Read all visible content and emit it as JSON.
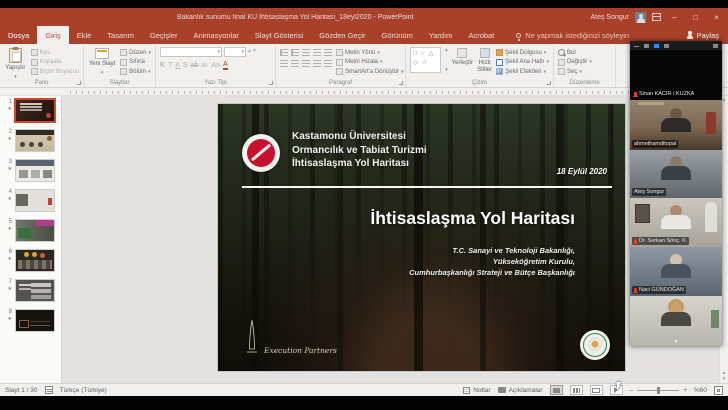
{
  "chrome": {
    "title": "Bakanlık sunumu final KU İhtisaslaşma Yol Haritası_18eyl2020  -  PowerPoint",
    "user_name": "Ateş Songur",
    "minimize": "–",
    "maximize": "□",
    "close": "×"
  },
  "icons": {
    "dropdown": "▾",
    "up": "▴",
    "down": "▾",
    "star": "★"
  },
  "ribbon": {
    "tabs": [
      "Dosya",
      "Giriş",
      "Ekle",
      "Tasarım",
      "Geçişler",
      "Animasyonlar",
      "Slayt Gösterisi",
      "Gözden Geçir",
      "Görünüm",
      "Yardım",
      "Acrobat"
    ],
    "selected_tab": "Giriş",
    "search_hint": "Ne yapmak istediğinizi söyleyin",
    "share": "Paylaş",
    "groups": {
      "pano": {
        "label": "Pano",
        "paste": "Yapıştır",
        "cut": "Kes",
        "copy": "Kopyala",
        "painter": "Biçim Boyacısı"
      },
      "slaytlar": {
        "label": "Slaytlar",
        "new_slide": "Yeni Slayt",
        "layout": "Düzen",
        "reset": "Sıfırla",
        "section": "Bölüm"
      },
      "yazitipi": {
        "label": "Yazı Tipi",
        "styles": [
          "K",
          "T",
          "A",
          "S",
          "ab",
          "AV",
          "Aa",
          "A"
        ]
      },
      "paragraf": {
        "label": "Paragraf",
        "text_direction": "Metin Yönü",
        "align_text": "Metni Hizala",
        "smartart": "SmartArt'a Dönüştür"
      },
      "cizim": {
        "label": "Çizim",
        "shapes_sample": "□ ○ △ ◇ ☆",
        "arrange": "Yerleştir",
        "quick_styles": "Hızlı Stiller",
        "shape_fill": "Şekil Dolgusu",
        "shape_outline": "Şekil Ana Hattı",
        "shape_effects": "Şekil Efektleri"
      },
      "duzenleme": {
        "label": "Düzenleme",
        "find": "Bul",
        "replace": "Değiştir",
        "select": "Seç"
      }
    }
  },
  "slides_panel": {
    "items": [
      {
        "n": "1"
      },
      {
        "n": "2"
      },
      {
        "n": "3"
      },
      {
        "n": "4"
      },
      {
        "n": "5"
      },
      {
        "n": "6"
      },
      {
        "n": "7"
      },
      {
        "n": "8"
      }
    ]
  },
  "slide": {
    "org_line1": "Kastamonu Üniversitesi",
    "org_line2": "Ormancılık ve Tabiat Turizmi",
    "org_line3": "İhtisaslaşma Yol Haritası",
    "date": "18 Eylül 2020",
    "title": "İhtisaslaşma Yol Haritası",
    "sub1": "T.C. Sanayi ve Teknoloji Bakanlığı,",
    "sub2": "Yükseköğretim Kurulu,",
    "sub3": "Cumhurbaşkanlığı  Strateji ve Bütçe Başkanlığı",
    "partner": "Execution Partners"
  },
  "status": {
    "slide_info": "Slayt 1 / 30",
    "language": "Türkçe (Türkiye)",
    "notes": "Notlar",
    "comments": "Açıklamalar",
    "zoom": "%60"
  },
  "meeting": {
    "participants": [
      {
        "name": "Sinan KACIR / KUZKA",
        "muted": true
      },
      {
        "name": "ahmethamditopal",
        "muted": false
      },
      {
        "name": "Ateş Songur",
        "muted": false
      },
      {
        "name": "Dr. Serkan Sönç. K.",
        "muted": true
      },
      {
        "name": "Naci GÜNDOĞAN",
        "muted": true
      },
      {
        "name": "",
        "muted": false
      }
    ]
  }
}
